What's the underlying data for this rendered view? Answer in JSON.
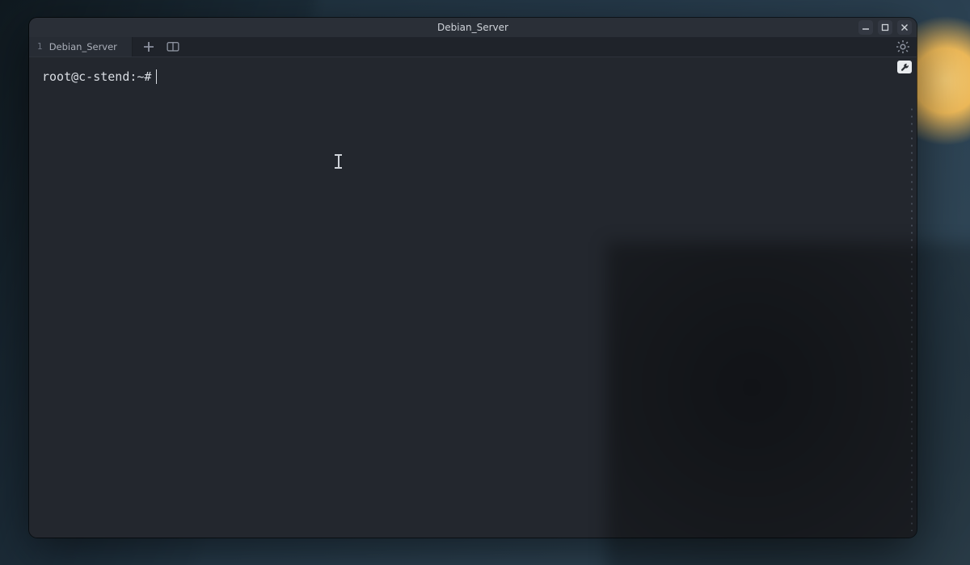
{
  "window": {
    "title": "Debian_Server"
  },
  "tabs": [
    {
      "index": "1",
      "label": "Debian_Server"
    }
  ],
  "terminal": {
    "prompt": "root@c-stend:~#",
    "input": ""
  },
  "icons": {
    "minimize": "minimize",
    "maximize": "maximize",
    "close": "close",
    "new_tab": "plus",
    "split": "split-horizontal",
    "settings": "gear",
    "tool": "wrench"
  }
}
